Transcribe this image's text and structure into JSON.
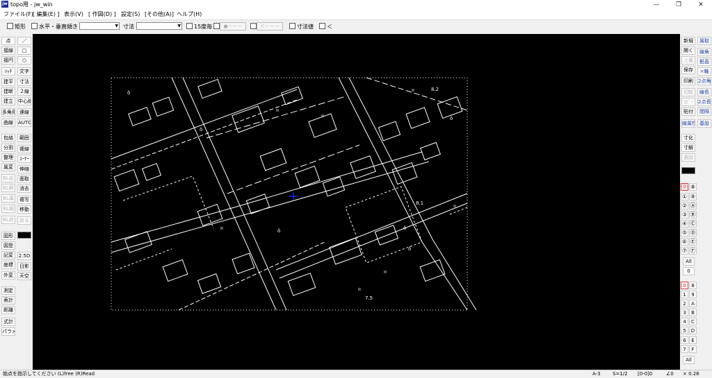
{
  "window": {
    "app_icon": "jw",
    "title": "topo用 - jw_win",
    "minimize": "—",
    "maximize": "❐",
    "close": "✕"
  },
  "menu": [
    "ファイル(F)",
    "[ 編集(E) ]",
    "表示(V)",
    "[ 作図(D) ]",
    "設定(S)",
    "[その他(A)]",
    "ヘルプ(H)"
  ],
  "toolbar": {
    "rect": "矩形",
    "hv": "水平・垂直",
    "slope": "傾き",
    "dim": "寸法",
    "deg15": "15度毎",
    "fwd": "●－－－",
    "back": "＜－－－",
    "dimval": "寸法値",
    "lt": "＜"
  },
  "left_col1": [
    "点",
    "接線",
    "接円",
    "ﾊｯﾁ",
    "建平",
    "建断",
    "建立",
    "多角形",
    "曲線",
    "包絡",
    "分割",
    "整理",
    "属変",
    "BL化",
    "BL解",
    "BL属",
    "BL編",
    "BL終",
    "図形",
    "図登",
    "記変",
    "座標",
    "外変",
    "測定",
    "表計",
    "距離",
    "式計",
    "パラメ"
  ],
  "left_col2": [
    "／",
    "□",
    "○",
    "文字",
    "寸法",
    "２線",
    "中心線",
    "連線",
    "AUTO",
    "範囲",
    "複線",
    "ｺｰﾅｰ",
    "伸縮",
    "面取",
    "消去",
    "複写",
    "移動",
    "戻る",
    "2.5D",
    "日影",
    "天空"
  ],
  "right_col1": [
    "新規",
    "開く",
    "上書",
    "保存",
    "印刷",
    "切取",
    "ｺﾋﾟｰ",
    "貼付",
    "線属性",
    "寸化",
    "寸解",
    "選図"
  ],
  "right_col2": [
    "属取",
    "線角",
    "鉛直",
    "×軸",
    "2点角",
    "線長",
    "2点長",
    "間隔",
    "基設"
  ],
  "layer_group_circles": [
    "⓪",
    "①",
    "②",
    "③",
    "④",
    "⑤",
    "⑥",
    "⑦"
  ],
  "layer_group_letters": [
    "⑧",
    "⑨",
    "Ⓐ",
    "Ⓑ",
    "Ⓒ",
    "Ⓓ",
    "Ⓔ",
    "Ⓕ"
  ],
  "layer_all": "All",
  "layer_zero": "0",
  "layers_left": [
    "0",
    "1",
    "2",
    "3",
    "4",
    "5",
    "6",
    "7"
  ],
  "layers_right": [
    "8",
    "9",
    "A",
    "B",
    "C",
    "D",
    "E",
    "F"
  ],
  "layers_all": "All",
  "map_labels": [
    "8.2",
    "8.1",
    "7.5"
  ],
  "status": {
    "message": "始点を指示してください (L)free (R)Read",
    "paper": "A-3",
    "scale": "S=1/2",
    "layer": "[0-0]0",
    "angle": "∠0",
    "zoom": "× 0.26"
  },
  "colors": {
    "canvas_bg": "#000000",
    "line": "#ffffff",
    "cursor": "#2030ff",
    "accent_red": "#c02020"
  }
}
